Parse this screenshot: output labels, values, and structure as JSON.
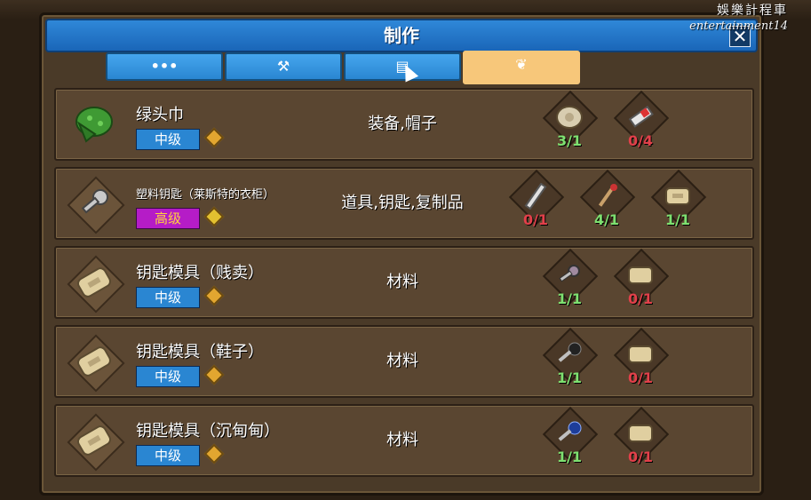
{
  "watermark": {
    "line1": "娛樂計程車",
    "line2": "entertainment14"
  },
  "window": {
    "title": "制作",
    "close_label": "✕"
  },
  "tabs": [
    {
      "label": "•••",
      "icon": "more-icon",
      "active": false
    },
    {
      "label": "⚒",
      "icon": "tools-icon",
      "active": false
    },
    {
      "label": "▤",
      "icon": "scroll-icon",
      "active": false
    },
    {
      "label": "❦",
      "icon": "feather-icon",
      "active": true
    }
  ],
  "recipes": [
    {
      "name": "绿头巾",
      "tier": "中级",
      "category": "装备,帽子",
      "icon": "green-bandana-icon",
      "materials": [
        {
          "icon": "cloth-roll-icon",
          "count": "3/1",
          "ok": true
        },
        {
          "icon": "tape-icon",
          "count": "0/4",
          "ok": false
        }
      ]
    },
    {
      "name": "塑料钥匙（莱斯特的衣柜）",
      "tier": "高级",
      "category": "道具,钥匙,复制品",
      "icon": "plastic-key-icon",
      "materials": [
        {
          "icon": "tube-icon",
          "count": "0/1",
          "ok": false
        },
        {
          "icon": "match-icon",
          "count": "4/1",
          "ok": true
        },
        {
          "icon": "key-mold-icon",
          "count": "1/1",
          "ok": true
        }
      ]
    },
    {
      "name": "钥匙模具（贱卖）",
      "tier": "中级",
      "category": "材料",
      "icon": "key-mold-icon",
      "materials": [
        {
          "icon": "keys-icon",
          "count": "1/1",
          "ok": true
        },
        {
          "icon": "soap-icon",
          "count": "0/1",
          "ok": false
        }
      ]
    },
    {
      "name": "钥匙模具（鞋子）",
      "tier": "中级",
      "category": "材料",
      "icon": "key-mold-icon",
      "materials": [
        {
          "icon": "black-key-icon",
          "count": "1/1",
          "ok": true
        },
        {
          "icon": "soap-icon",
          "count": "0/1",
          "ok": false
        }
      ]
    },
    {
      "name": "钥匙模具（沉甸甸）",
      "tier": "中级",
      "category": "材料",
      "icon": "key-mold-icon",
      "materials": [
        {
          "icon": "blue-key-icon",
          "count": "1/1",
          "ok": true
        },
        {
          "icon": "soap-icon",
          "count": "0/1",
          "ok": false
        }
      ]
    }
  ],
  "colors": {
    "title_blue": "#2a86d2",
    "tab_active": "#f7c77a",
    "ok_green": "#7ee070",
    "missing_red": "#e2404a",
    "tier_high": "#b51cc7"
  }
}
